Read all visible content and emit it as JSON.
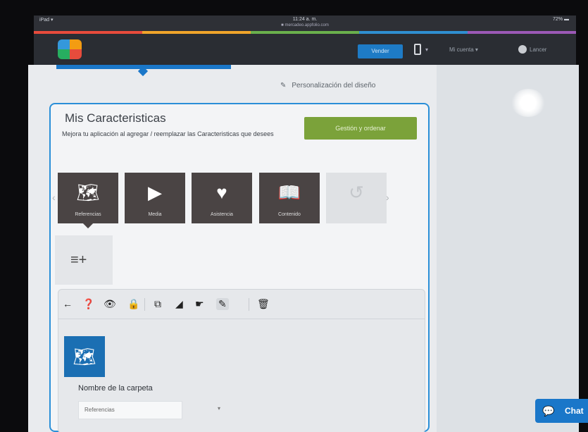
{
  "status_bar": {
    "carrier": "iPad ▾",
    "time": "11:24 a. m.",
    "url": "■ mercadeo.appfolio.com",
    "battery": "72% ▬"
  },
  "navbar": {
    "primary_button": "Vender",
    "device_caret": "▾",
    "account_menu": "Mi cuenta ▾",
    "user_menu": "Lancer"
  },
  "personalize_link": "Personalización del diseño",
  "card": {
    "title": "Mis Caracteristicas",
    "description": "Mejora tu aplicación al agregar / reemplazar las Caracteristicas que desees",
    "green_button": "Gestión y ordenar"
  },
  "tiles": [
    {
      "glyph": "🗺",
      "label": "Referencias"
    },
    {
      "glyph": "▶",
      "label": "Media"
    },
    {
      "glyph": "♥",
      "label": "Asistencia"
    },
    {
      "glyph": "📖",
      "label": "Contenido"
    },
    {
      "glyph": "↺",
      "label": ""
    }
  ],
  "nav_arrows": {
    "left": "‹",
    "right": "›"
  },
  "add_tile_icon": "≡+",
  "toolbar": {
    "back": "←",
    "help": "❓",
    "eye": "👁",
    "lock": "🔒",
    "copy": "⧉",
    "signal": "◢",
    "hand": "☛",
    "edit": "✎",
    "trash": "🗑"
  },
  "folder": {
    "icon": "🗺",
    "label": "Nombre de la carpeta",
    "value": "Referencias",
    "caret": "▾"
  },
  "chat": {
    "icon": "💬",
    "label": "Chat"
  }
}
